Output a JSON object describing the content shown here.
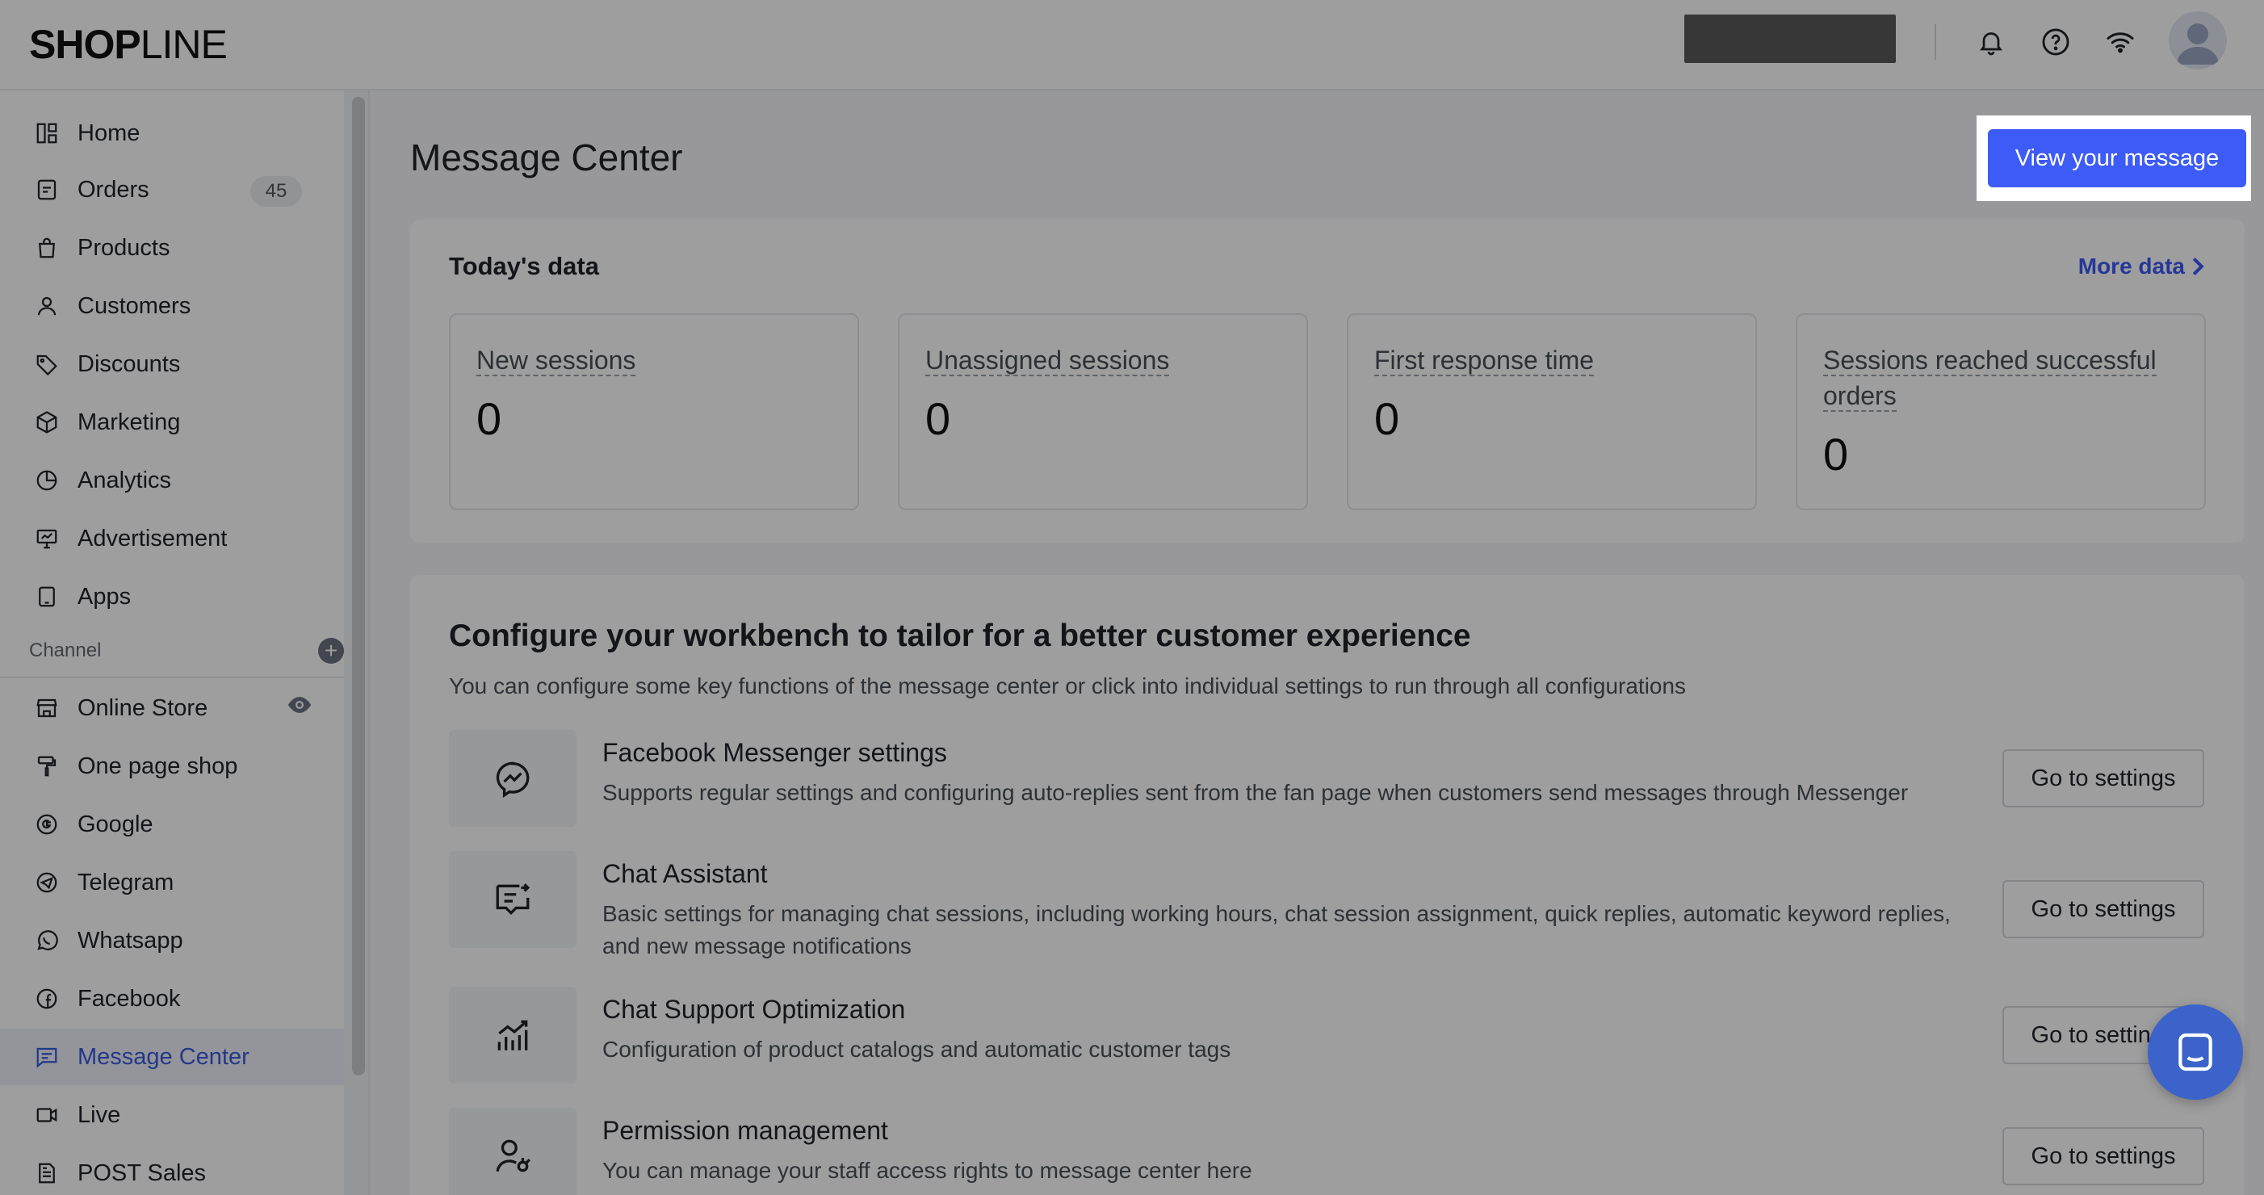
{
  "brand": {
    "logo_bold": "SHOP",
    "logo_thin": "LINE"
  },
  "sidebar": {
    "items": [
      {
        "label": "Home",
        "icon": "home-icon"
      },
      {
        "label": "Orders",
        "icon": "orders-icon",
        "badge": "45"
      },
      {
        "label": "Products",
        "icon": "bag-icon"
      },
      {
        "label": "Customers",
        "icon": "person-icon"
      },
      {
        "label": "Discounts",
        "icon": "tag-icon"
      },
      {
        "label": "Marketing",
        "icon": "cube-icon"
      },
      {
        "label": "Analytics",
        "icon": "pie-chart-icon"
      },
      {
        "label": "Advertisement",
        "icon": "monitor-icon"
      },
      {
        "label": "Apps",
        "icon": "tablet-icon"
      }
    ],
    "channel_label": "Channel",
    "channels": [
      {
        "label": "Online Store",
        "icon": "store-icon"
      },
      {
        "label": "One page shop",
        "icon": "paint-roller-icon"
      },
      {
        "label": "Google",
        "icon": "google-icon"
      },
      {
        "label": "Telegram",
        "icon": "telegram-icon"
      },
      {
        "label": "Whatsapp",
        "icon": "whatsapp-icon"
      },
      {
        "label": "Facebook",
        "icon": "facebook-icon"
      },
      {
        "label": "Message Center",
        "icon": "message-icon",
        "active": true
      },
      {
        "label": "Live",
        "icon": "video-icon"
      },
      {
        "label": "POST Sales",
        "icon": "document-icon"
      }
    ]
  },
  "main": {
    "title": "Message Center",
    "primary_button": "View your message",
    "today": {
      "title": "Today's data",
      "more_link": "More data",
      "stats": [
        {
          "label": "New sessions",
          "value": "0"
        },
        {
          "label": "Unassigned sessions",
          "value": "0"
        },
        {
          "label": "First response time",
          "value": "0"
        },
        {
          "label": "Sessions reached successful orders",
          "value": "0"
        }
      ]
    },
    "configure": {
      "title": "Configure your workbench to tailor for a better customer experience",
      "subtitle": "You can configure some key functions of the message center or click into individual settings to run through all configurations",
      "items": [
        {
          "name": "Facebook Messenger settings",
          "desc": "Supports regular settings and configuring auto-replies sent from the fan page when customers send messages through Messenger",
          "button": "Go to settings",
          "icon": "messenger-icon"
        },
        {
          "name": "Chat Assistant",
          "desc": "Basic settings for managing chat sessions, including working hours, chat session assignment, quick replies, automatic keyword replies, and new message notifications",
          "button": "Go to settings",
          "icon": "chat-assistant-icon"
        },
        {
          "name": "Chat Support Optimization",
          "desc": "Configuration of product catalogs and automatic customer tags",
          "button": "Go to settings",
          "icon": "growth-chart-icon"
        },
        {
          "name": "Permission management",
          "desc": "You can manage your staff access rights to message center here",
          "button": "Go to settings",
          "icon": "user-permission-icon"
        }
      ]
    }
  },
  "colors": {
    "accent": "#3d5bf6",
    "active_bg": "#eef1fb",
    "chat_bubble": "#3b63c9"
  }
}
